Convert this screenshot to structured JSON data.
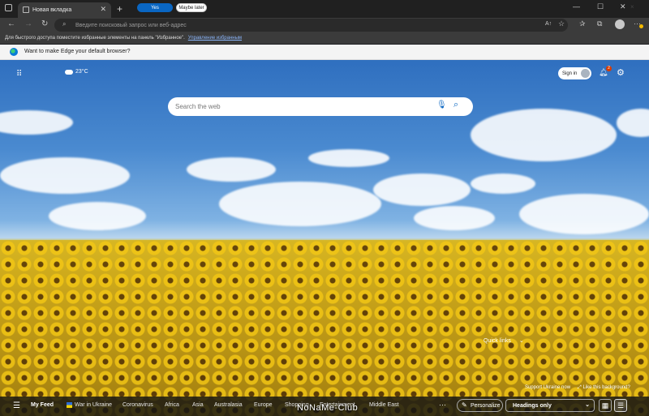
{
  "browser": {
    "tab_title": "Новая вкладка",
    "new_tab": "+",
    "window_controls": [
      "—",
      "☐",
      "✕"
    ],
    "address_placeholder": "Введите поисковый запрос или веб-адрес",
    "favorites_hint": "Для быстрого доступа поместите избранные элементы на панель \"Избранное\".",
    "favorites_link": "Управление избранным"
  },
  "default_browser_bar": {
    "message": "Want to make Edge your default browser?",
    "yes_label": "Yes",
    "later_label": "Maybe later",
    "close": "×"
  },
  "page": {
    "weather_temp": "23°C",
    "sign_in": "Sign in",
    "notifications": "2",
    "search_placeholder": "Search the web",
    "quick_links": "Quick links",
    "support": "Support Ukraine now",
    "like_bg": "Like this background?",
    "watermark": "NoNaMe-Club"
  },
  "feed": {
    "my_feed": "My Feed",
    "categories": [
      "War in Ukraine",
      "Coronavirus",
      "Africa",
      "Asia",
      "Australasia",
      "Europe",
      "Shopping",
      "Entertainment",
      "Middle East"
    ],
    "more": "···",
    "personalize": "Personalize",
    "headings": "Headings only"
  },
  "colors": {
    "accent": "#0a66c2",
    "badge": "#d83b01"
  },
  "icons": [
    "apps-grid-icon",
    "weather-cloud-icon",
    "bell-icon",
    "gear-icon",
    "mic-icon",
    "search-icon",
    "pencil-icon",
    "grid-view-icon",
    "list-view-icon"
  ]
}
